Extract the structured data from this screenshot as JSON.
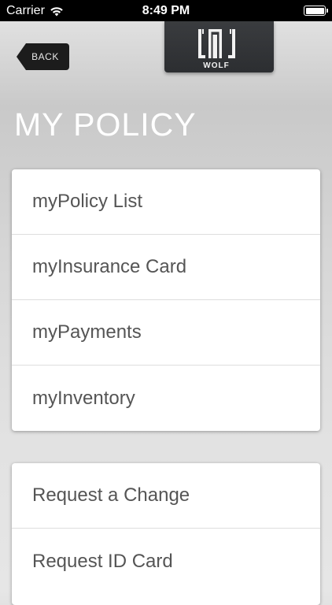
{
  "status_bar": {
    "carrier": "Carrier",
    "time": "8:49 PM",
    "wifi_icon": "wifi-icon",
    "battery_icon": "battery-icon"
  },
  "header": {
    "back_label": "BACK",
    "logo_text": "WOLF",
    "title": "MY POLICY"
  },
  "menu_primary": {
    "items": [
      {
        "label": "myPolicy List"
      },
      {
        "label": "myInsurance Card"
      },
      {
        "label": "myPayments"
      },
      {
        "label": "myInventory"
      }
    ]
  },
  "menu_secondary": {
    "items": [
      {
        "label": "Request a Change"
      },
      {
        "label": "Request ID Card"
      }
    ]
  },
  "colors": {
    "status_bar_bg": "#000000",
    "back_button_bg": "#1c1c1c",
    "logo_bg": "#333538",
    "title_text": "#ffffff",
    "menu_text": "#555555",
    "card_bg": "#ffffff"
  }
}
